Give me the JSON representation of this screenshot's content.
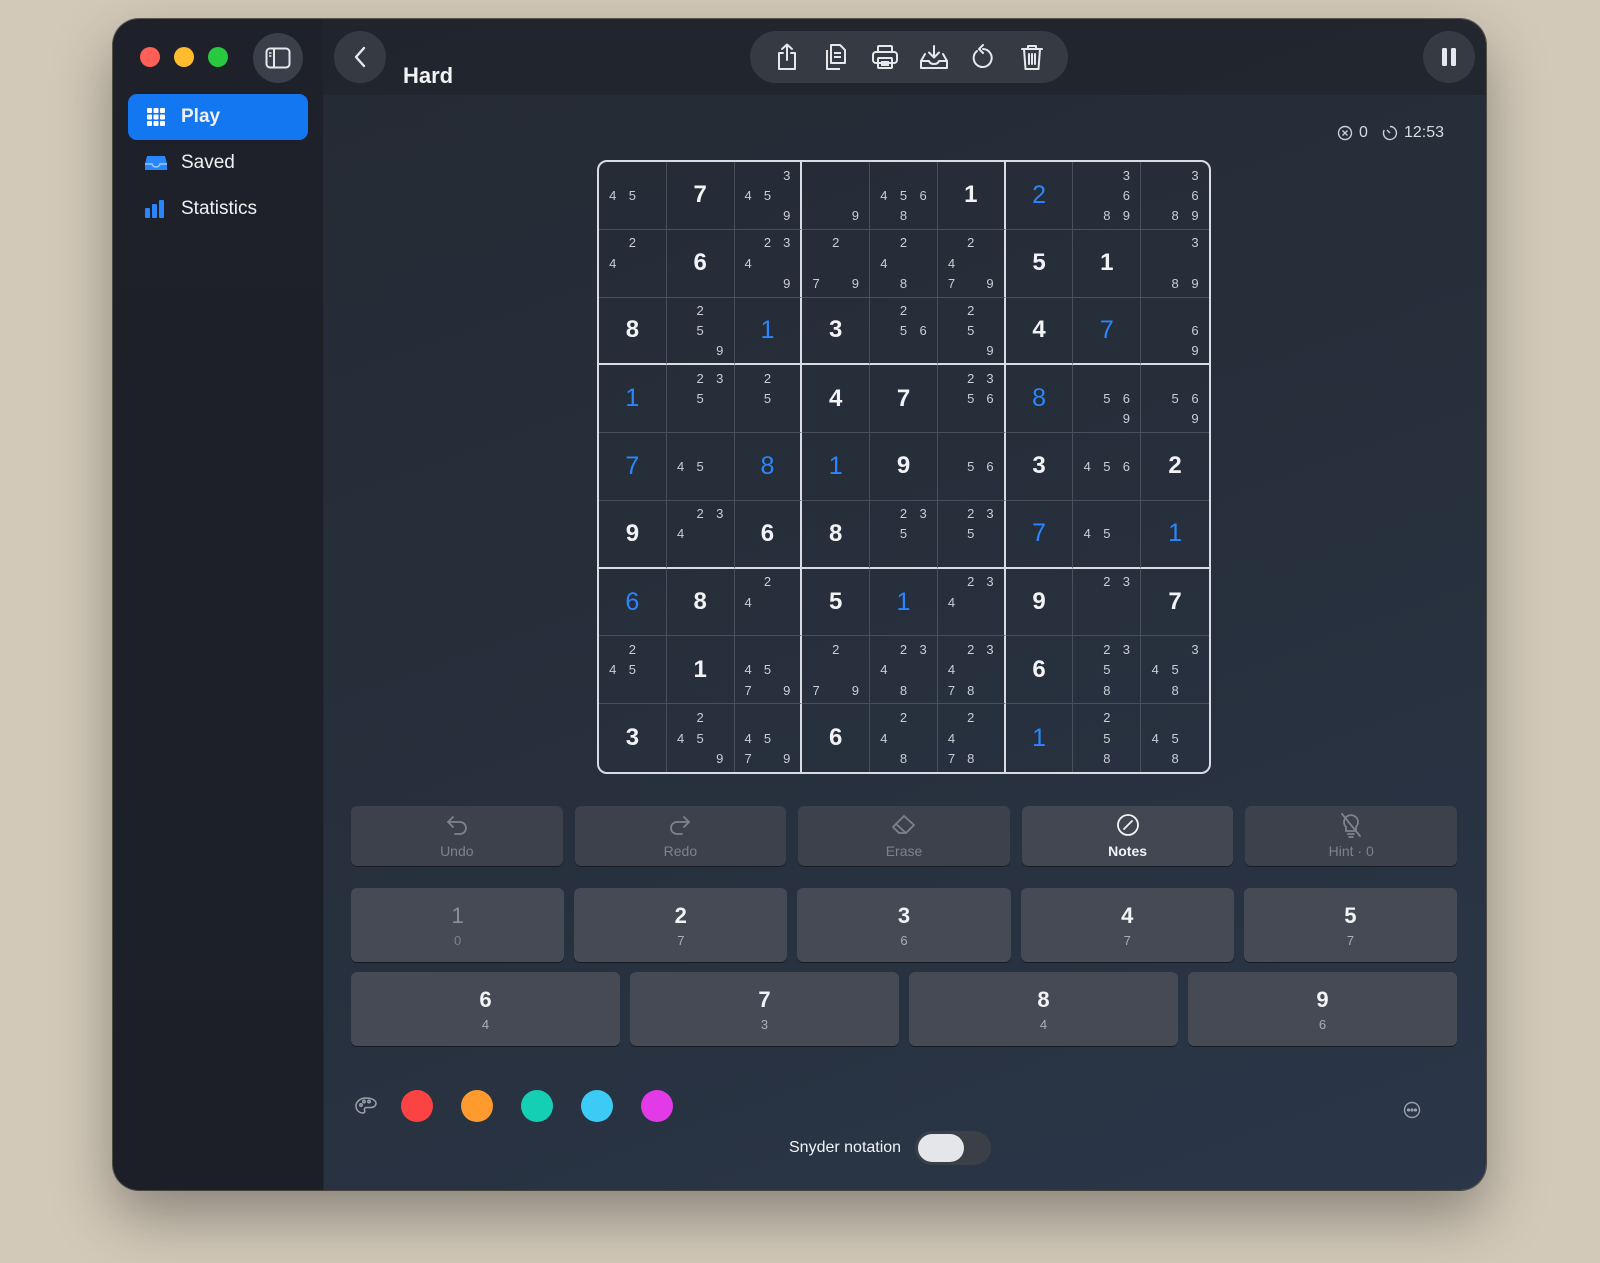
{
  "toolbar": {
    "title": "Hard"
  },
  "sidebar": {
    "items": [
      {
        "label": "Play",
        "icon": "grid-icon",
        "active": true
      },
      {
        "label": "Saved",
        "icon": "tray-icon",
        "active": false
      },
      {
        "label": "Statistics",
        "icon": "bar-chart-icon",
        "active": false
      }
    ]
  },
  "stats": {
    "mistakes": "0",
    "time": "12:53"
  },
  "colors": {
    "accent": "#1477f2",
    "entered": "#2a86ff"
  },
  "board": [
    [
      {
        "n": "45"
      },
      {
        "v": "7"
      },
      {
        "n": "3459"
      },
      {
        "n": "9"
      },
      {
        "n": "4568"
      },
      {
        "v": "1"
      },
      {
        "v": "2",
        "u": 1
      },
      {
        "n": "3689"
      },
      {
        "n": "3689"
      }
    ],
    [
      {
        "n": "24"
      },
      {
        "v": "6"
      },
      {
        "n": "2349"
      },
      {
        "n": "279"
      },
      {
        "n": "248"
      },
      {
        "n": "2479"
      },
      {
        "v": "5"
      },
      {
        "v": "1"
      },
      {
        "n": "389"
      }
    ],
    [
      {
        "v": "8"
      },
      {
        "n": "259"
      },
      {
        "v": "1",
        "u": 1
      },
      {
        "v": "3"
      },
      {
        "n": "256"
      },
      {
        "n": "259"
      },
      {
        "v": "4"
      },
      {
        "v": "7",
        "u": 1
      },
      {
        "n": "69"
      }
    ],
    [
      {
        "v": "1",
        "u": 1
      },
      {
        "n": "235"
      },
      {
        "n": "25"
      },
      {
        "v": "4"
      },
      {
        "v": "7"
      },
      {
        "n": "2356"
      },
      {
        "v": "8",
        "u": 1
      },
      {
        "n": "569"
      },
      {
        "n": "569"
      }
    ],
    [
      {
        "v": "7",
        "u": 1
      },
      {
        "n": "45"
      },
      {
        "v": "8",
        "u": 1
      },
      {
        "v": "1",
        "u": 1
      },
      {
        "v": "9"
      },
      {
        "n": "56"
      },
      {
        "v": "3"
      },
      {
        "n": "456"
      },
      {
        "v": "2"
      }
    ],
    [
      {
        "v": "9"
      },
      {
        "n": "234"
      },
      {
        "v": "6"
      },
      {
        "v": "8"
      },
      {
        "n": "235"
      },
      {
        "n": "235"
      },
      {
        "v": "7",
        "u": 1
      },
      {
        "n": "45"
      },
      {
        "v": "1",
        "u": 1
      }
    ],
    [
      {
        "v": "6",
        "u": 1
      },
      {
        "v": "8"
      },
      {
        "n": "24"
      },
      {
        "v": "5"
      },
      {
        "v": "1",
        "u": 1
      },
      {
        "n": "234"
      },
      {
        "v": "9"
      },
      {
        "n": "23"
      },
      {
        "v": "7"
      }
    ],
    [
      {
        "n": "245"
      },
      {
        "v": "1"
      },
      {
        "n": "4579"
      },
      {
        "n": "279"
      },
      {
        "n": "2348"
      },
      {
        "n": "23478"
      },
      {
        "v": "6"
      },
      {
        "n": "2358"
      },
      {
        "n": "3458"
      }
    ],
    [
      {
        "v": "3"
      },
      {
        "n": "2459"
      },
      {
        "n": "4579"
      },
      {
        "v": "6"
      },
      {
        "n": "248"
      },
      {
        "n": "2478"
      },
      {
        "v": "1",
        "u": 1
      },
      {
        "n": "258"
      },
      {
        "n": "458"
      }
    ]
  ],
  "actions": [
    {
      "label": "Undo",
      "icon": "undo-icon",
      "enabled": false
    },
    {
      "label": "Redo",
      "icon": "redo-icon",
      "enabled": false
    },
    {
      "label": "Erase",
      "icon": "eraser-icon",
      "enabled": false
    },
    {
      "label": "Notes",
      "icon": "notes-icon",
      "enabled": true
    },
    {
      "label": "Hint · 0",
      "icon": "hint-icon",
      "enabled": false
    }
  ],
  "numbers": [
    {
      "digit": "1",
      "count": "0"
    },
    {
      "digit": "2",
      "count": "7"
    },
    {
      "digit": "3",
      "count": "6"
    },
    {
      "digit": "4",
      "count": "7"
    },
    {
      "digit": "5",
      "count": "7"
    },
    {
      "digit": "6",
      "count": "4"
    },
    {
      "digit": "7",
      "count": "3"
    },
    {
      "digit": "8",
      "count": "4"
    },
    {
      "digit": "9",
      "count": "6"
    }
  ],
  "palette": [
    "#fb4343",
    "#ff9a2e",
    "#14cfb3",
    "#3ccbf5",
    "#e13ae6"
  ],
  "snyder": {
    "label": "Snyder notation",
    "on": false
  }
}
